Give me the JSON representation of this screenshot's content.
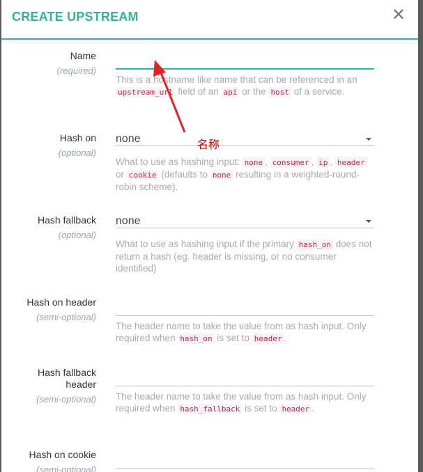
{
  "modal": {
    "title": "CREATE UPSTREAM",
    "close_icon": "close-icon"
  },
  "fields": [
    {
      "label": "Name",
      "qualifier": "(required)",
      "value": "",
      "type": "text",
      "help": [
        {
          "t": "This is a hostname like name that can be referenced in an "
        },
        {
          "t": "upstream_url",
          "code": true
        },
        {
          "t": " field of an "
        },
        {
          "t": "api",
          "code": true
        },
        {
          "t": " or the "
        },
        {
          "t": "host",
          "code": true
        },
        {
          "t": " of a service."
        }
      ]
    },
    {
      "label": "Hash on",
      "qualifier": "(optional)",
      "value": "none",
      "type": "select",
      "help": [
        {
          "t": "What to use as hashing input: "
        },
        {
          "t": "none",
          "code": true
        },
        {
          "t": ", "
        },
        {
          "t": "consumer",
          "code": true
        },
        {
          "t": ", "
        },
        {
          "t": "ip",
          "code": true
        },
        {
          "t": ", "
        },
        {
          "t": "header",
          "code": true
        },
        {
          "t": " or "
        },
        {
          "t": "cookie",
          "code": true
        },
        {
          "t": " (defaults to "
        },
        {
          "t": "none",
          "code": true
        },
        {
          "t": " resulting in a weighted-round-robin scheme)."
        }
      ]
    },
    {
      "label": "Hash fallback",
      "qualifier": "(optional)",
      "value": "none",
      "type": "select",
      "help": [
        {
          "t": "What to use as hashing input if the primary "
        },
        {
          "t": "hash_on",
          "code": true
        },
        {
          "t": " does not return a hash (eg. header is missing, or no consumer identified)"
        }
      ]
    },
    {
      "label": "Hash on header",
      "qualifier": "(semi-optional)",
      "value": "",
      "type": "text",
      "help": [
        {
          "t": "The header name to take the value from as hash input. Only required when "
        },
        {
          "t": "hash_on",
          "code": true
        },
        {
          "t": " is set to "
        },
        {
          "t": "header",
          "code": true
        },
        {
          "t": "."
        }
      ]
    },
    {
      "label": "Hash fallback header",
      "qualifier": "(semi-optional)",
      "value": "",
      "type": "text",
      "help": [
        {
          "t": "The header name to take the value from as hash input. Only required when "
        },
        {
          "t": "hash_fallback",
          "code": true
        },
        {
          "t": " is set to "
        },
        {
          "t": "header",
          "code": true
        },
        {
          "t": "."
        }
      ]
    },
    {
      "label": "Hash on cookie",
      "qualifier": "(semi-optional)",
      "value": "",
      "type": "text",
      "help": []
    }
  ],
  "annotation": {
    "text": "名称",
    "color": "#dd1111"
  },
  "colors": {
    "accent": "#2fb59a",
    "code": "#c7254e"
  }
}
